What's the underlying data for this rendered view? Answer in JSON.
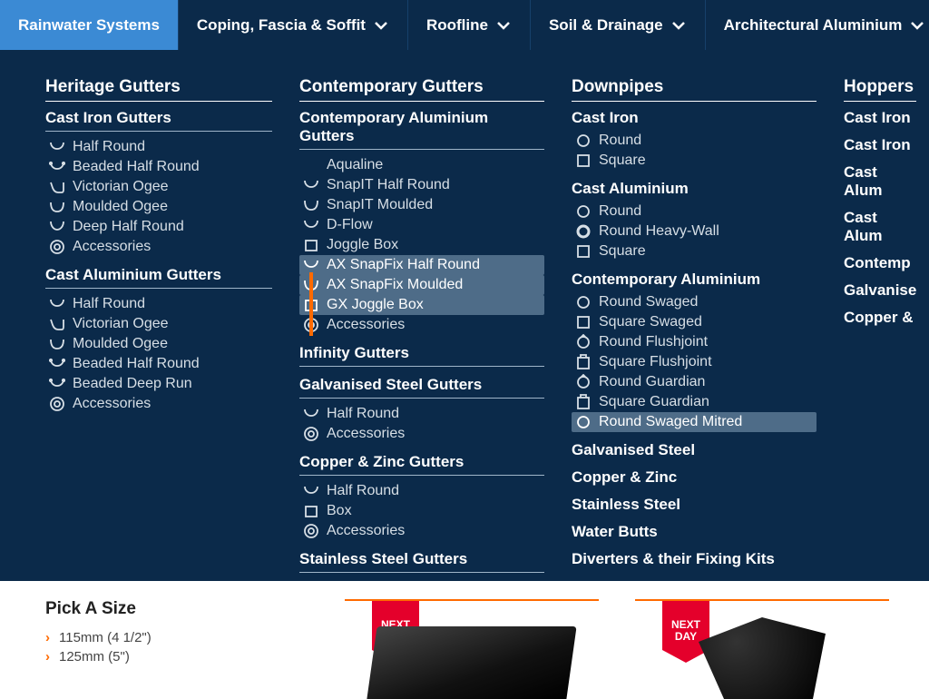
{
  "nav": [
    {
      "label": "Rainwater Systems",
      "chevron": false,
      "active": true
    },
    {
      "label": "Coping, Fascia & Soffit",
      "chevron": true
    },
    {
      "label": "Roofline",
      "chevron": true
    },
    {
      "label": "Soil & Drainage",
      "chevron": true
    },
    {
      "label": "Architectural Aluminium",
      "chevron": true
    }
  ],
  "col1": {
    "heading": "Heritage Gutters",
    "groups": [
      {
        "title": "Cast Iron Gutters",
        "first": true,
        "items": [
          {
            "icon": "half-round",
            "label": "Half Round"
          },
          {
            "icon": "beaded",
            "label": "Beaded Half Round"
          },
          {
            "icon": "ogee",
            "label": "Victorian Ogee"
          },
          {
            "icon": "moulded",
            "label": "Moulded Ogee"
          },
          {
            "icon": "deep-half",
            "label": "Deep Half Round"
          },
          {
            "icon": "acc",
            "label": "Accessories"
          }
        ]
      },
      {
        "title": "Cast Aluminium Gutters",
        "items": [
          {
            "icon": "half-round",
            "label": "Half Round"
          },
          {
            "icon": "ogee",
            "label": "Victorian Ogee"
          },
          {
            "icon": "moulded",
            "label": "Moulded Ogee"
          },
          {
            "icon": "beaded",
            "label": "Beaded Half Round"
          },
          {
            "icon": "beaded",
            "label": "Beaded Deep Run"
          },
          {
            "icon": "acc",
            "label": "Accessories"
          }
        ]
      }
    ]
  },
  "col2": {
    "heading": "Contemporary Gutters",
    "groups": [
      {
        "title": "Contemporary Aluminium Gutters",
        "first": true,
        "items": [
          {
            "icon": "indent",
            "label": "Aqualine"
          },
          {
            "icon": "half-round",
            "label": "SnapIT Half Round"
          },
          {
            "icon": "moulded",
            "label": "SnapIT Moulded"
          },
          {
            "icon": "half-round",
            "label": "D-Flow"
          },
          {
            "icon": "box",
            "label": "Joggle Box"
          },
          {
            "icon": "half-round",
            "label": "AX SnapFix Half Round",
            "hl": true
          },
          {
            "icon": "moulded",
            "label": "AX SnapFix Moulded",
            "hl": true
          },
          {
            "icon": "box",
            "label": "GX Joggle Box",
            "hl": true
          },
          {
            "icon": "acc",
            "label": "Accessories"
          }
        ]
      },
      {
        "title": "Infinity Gutters",
        "noitems": true
      },
      {
        "title": "Galvanised Steel Gutters",
        "items": [
          {
            "icon": "half-round",
            "label": "Half Round"
          },
          {
            "icon": "acc",
            "label": "Accessories"
          }
        ]
      },
      {
        "title": "Copper & Zinc Gutters",
        "items": [
          {
            "icon": "half-round",
            "label": "Half Round"
          },
          {
            "icon": "box",
            "label": "Box"
          },
          {
            "icon": "acc",
            "label": "Accessories"
          }
        ]
      },
      {
        "title": "Stainless Steel Gutters",
        "noitems": true
      }
    ]
  },
  "col3": {
    "heading": "Downpipes",
    "groups": [
      {
        "title": "Cast Iron",
        "first": true,
        "noline": true,
        "items": [
          {
            "icon": "circle",
            "label": "Round"
          },
          {
            "icon": "square",
            "label": "Square"
          }
        ]
      },
      {
        "title": "Cast Aluminium",
        "noline": true,
        "items": [
          {
            "icon": "circle",
            "label": "Round"
          },
          {
            "icon": "circle-heavy",
            "label": "Round Heavy-Wall"
          },
          {
            "icon": "square",
            "label": "Square"
          }
        ]
      },
      {
        "title": "Contemporary Aluminium",
        "noline": true,
        "items": [
          {
            "icon": "circle",
            "label": "Round Swaged"
          },
          {
            "icon": "square",
            "label": "Square Swaged"
          },
          {
            "icon": "circle-notch",
            "label": "Round Flushjoint"
          },
          {
            "icon": "square-notch",
            "label": "Square Flushjoint"
          },
          {
            "icon": "circle-notch",
            "label": "Round Guardian"
          },
          {
            "icon": "square-notch",
            "label": "Square Guardian"
          },
          {
            "icon": "circle",
            "label": "Round Swaged Mitred",
            "hl": true
          }
        ]
      },
      {
        "title": "Galvanised Steel",
        "noline": true,
        "noitems": true
      },
      {
        "title": "Copper & Zinc",
        "noline": true,
        "noitems": true
      },
      {
        "title": "Stainless Steel",
        "noline": true,
        "noitems": true
      },
      {
        "title": "Water Butts",
        "noline": true,
        "noitems": true
      },
      {
        "title": "Diverters & their Fixing Kits",
        "noline": true,
        "noitems": true
      }
    ]
  },
  "col4": {
    "heading": "Hoppers",
    "groups": [
      {
        "title": "Cast Iron",
        "noline": true,
        "noitems": true,
        "first": true
      },
      {
        "title": "Cast Iron",
        "noline": true,
        "noitems": true
      },
      {
        "title": "Cast Alum",
        "noline": true,
        "noitems": true
      },
      {
        "title": "Cast Alum",
        "noline": true,
        "noitems": true
      },
      {
        "title": "Contemp",
        "noline": true,
        "noitems": true
      },
      {
        "title": "Galvanise",
        "noline": true,
        "noitems": true
      },
      {
        "title": "Copper &",
        "noline": true,
        "noitems": true
      }
    ]
  },
  "sidebar": {
    "title": "Pick A Size",
    "sizes": [
      "115mm (4 1/2\")",
      "125mm (5\")"
    ]
  },
  "badge": {
    "line1": "NEXT",
    "line2": "DAY"
  }
}
